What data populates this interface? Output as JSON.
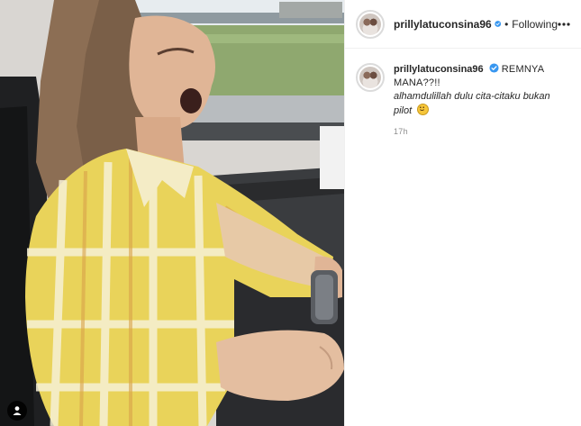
{
  "post": {
    "username": "prillylatuconsina96",
    "verified": true,
    "separator": "•",
    "follow_status": "Following",
    "more_icon": "more-horizontal-icon",
    "caption": {
      "line1": "REMNYA MANA??!!",
      "line2": "alhamdulillah dulu cita-citaku bukan pilot",
      "emoji": "slightly-smiling-face-emoji"
    },
    "timestamp": "17h"
  },
  "media": {
    "type": "video",
    "audio_icon": "user-tag-icon"
  },
  "colors": {
    "verified_badge": "#3897f0",
    "text": "#262626",
    "muted": "#8e8e8e",
    "divider": "#efefef"
  }
}
